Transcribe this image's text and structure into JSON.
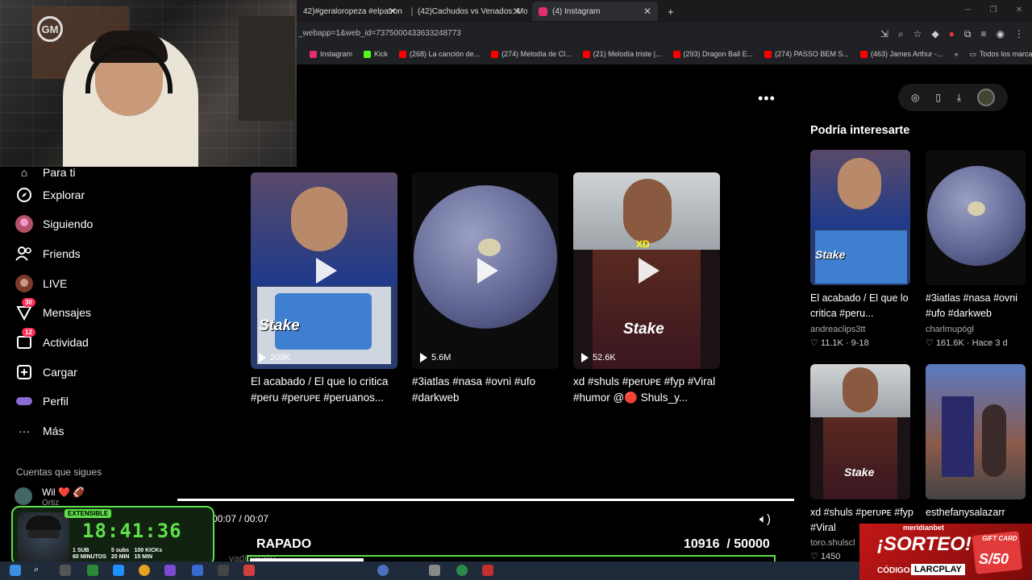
{
  "browser": {
    "tabs": [
      {
        "title": "42)#geraloropeza #elpatron #"
      },
      {
        "title": "(42)Cachudos vs Venados: Mon"
      },
      {
        "title": "(4) Instagram"
      }
    ],
    "url": "_webapp=1&web_id=7375000433633248773",
    "bookmarks": [
      {
        "label": "Instagram",
        "color": "#e1306c"
      },
      {
        "label": "Kick",
        "color": "#53fc18"
      },
      {
        "label": "(268) La canción de...",
        "color": "#ff0000"
      },
      {
        "label": "(274) Melodía de Cl...",
        "color": "#ff0000"
      },
      {
        "label": "(21) Melodía triste |...",
        "color": "#ff0000"
      },
      {
        "label": "(293) Dragon Ball E...",
        "color": "#ff0000"
      },
      {
        "label": "(274) PASSO BEM S...",
        "color": "#ff0000"
      },
      {
        "label": "(463) James Arthur -...",
        "color": "#ff0000"
      }
    ],
    "bookmarks_more": "»",
    "all_bookmarks": "Todos los marcadores"
  },
  "webcam": {
    "logo": "GM"
  },
  "sidebar": {
    "items": [
      {
        "label": "Para ti",
        "icon": "home-icon"
      },
      {
        "label": "Explorar",
        "icon": "compass-icon"
      },
      {
        "label": "Siguiendo",
        "icon": "following-avatar-icon"
      },
      {
        "label": "Friends",
        "icon": "friends-icon"
      },
      {
        "label": "LIVE",
        "icon": "live-avatar-icon"
      },
      {
        "label": "Mensajes",
        "icon": "messages-icon",
        "badge": "30"
      },
      {
        "label": "Actividad",
        "icon": "activity-icon",
        "badge": "12"
      },
      {
        "label": "Cargar",
        "icon": "upload-icon"
      },
      {
        "label": "Perfil",
        "icon": "profile-icon"
      },
      {
        "label": "Más",
        "icon": "more-icon"
      }
    ],
    "following_title": "Cuentas que sigues",
    "following_users": [
      {
        "name": "Wil ❤️ 🏈",
        "sub": "Ortiz"
      }
    ]
  },
  "videos": [
    {
      "views": "209K",
      "title": "El acabado / El que lo critica #peru #perᴜᴘᴇ #peruanos...",
      "overlay": "Stake"
    },
    {
      "views": "5.6M",
      "title": "#3iatlas #nasa #ovni #ufo #darkweb"
    },
    {
      "views": "52.6K",
      "title": "xd #shuls #perᴜᴘᴇ #fyp #Viral #humor @🔴 Shuls_y...",
      "overlay": "Stake"
    }
  ],
  "suggested": {
    "title": "Podría interesarte",
    "items": [
      {
        "title": "El acabado / El que lo critica #peru...",
        "user": "andreaclips3tt",
        "likes": "11.1K",
        "date": "9-18",
        "overlay": "Stake"
      },
      {
        "title": "#3iatlas #nasa #ovni #ufo #darkweb",
        "user": "charlmupógl",
        "likes": "161.6K",
        "date": "Hace 3 d"
      },
      {
        "title": "xd #shuls #perᴜᴘᴇ #fyp #Viral",
        "user": "toro.shulscl",
        "likes": "1450",
        "overlay": "Stake"
      },
      {
        "title": "esthefanysalazarr"
      }
    ]
  },
  "player": {
    "timecode": "00:07 / 00:07",
    "progress": 1.0
  },
  "stream_overlay": {
    "tag": "EXTENSIBLE",
    "clock": "18:41:36",
    "stats": [
      {
        "line1": "1 SUB",
        "line2": "60 MINUTOS"
      },
      {
        "line1": "5 subs",
        "line2": "20 MIN"
      },
      {
        "line1": "100 KICKs",
        "line2": "15 MIN"
      }
    ],
    "goal_label": "RAPADO",
    "goal_count": "10916",
    "goal_total": "/ 50000",
    "goal_fraction": 0.218,
    "goal_user": "yadiparaliu"
  },
  "sponsor": {
    "brand": "meridianbet",
    "headline": "¡SORTEO!",
    "code_label": "CÓDIGO:",
    "code": "LARCPLAY",
    "gift_label": "GIFT CARD",
    "gift_value": "S/50"
  },
  "colors": {
    "accent": "#fe2c55",
    "overlay_green": "#5fe04b"
  }
}
